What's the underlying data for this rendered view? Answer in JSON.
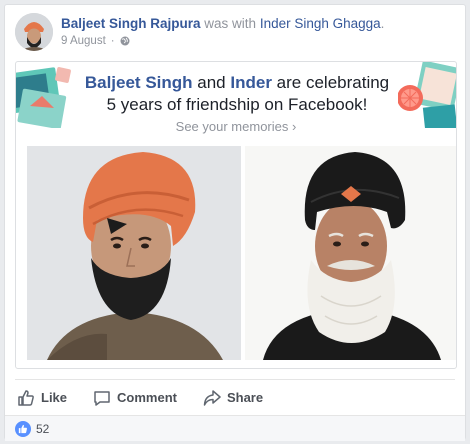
{
  "post": {
    "author": "Baljeet Singh Rajpura",
    "was_with": "was with",
    "tagged": "Inder Singh Ghagga",
    "date": "9 August",
    "date_sep": "·",
    "privacy_icon": "globe-icon"
  },
  "memory": {
    "name1": "Baljeet Singh",
    "and": "and",
    "name2": "Inder",
    "text": "are celebrating 5 years of friendship on Facebook!",
    "see_memories": "See your memories",
    "chevron": "›"
  },
  "actions": {
    "like": "Like",
    "comment": "Comment",
    "share": "Share"
  },
  "reactions": {
    "count": "52",
    "icon": "like-icon"
  },
  "colors": {
    "link": "#365899",
    "muted": "#90949c",
    "like_blue": "#5890ff",
    "turban_orange": "#e4774a",
    "turban_black": "#1a1a1a"
  }
}
